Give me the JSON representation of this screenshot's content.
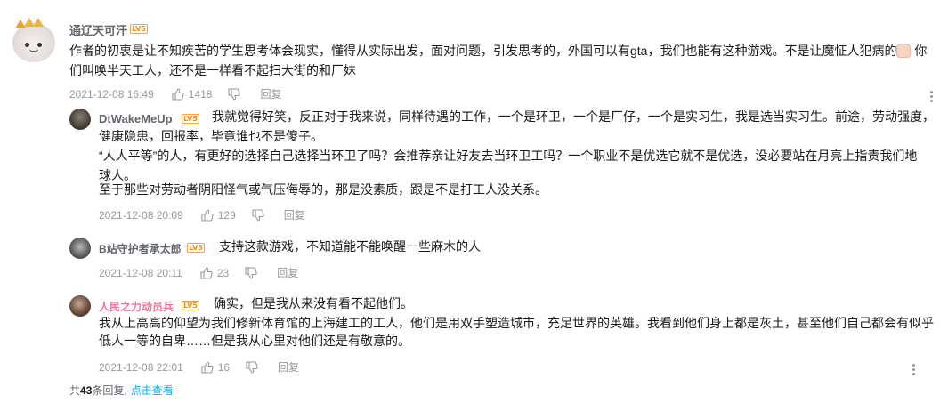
{
  "main_comment": {
    "username": "通辽天可汗",
    "level": "LV5",
    "text_line1_a": "作者的初衷是让不知疾苦的学生思考体会现实，懂得从实际出发，面对问题，引发思考的，外国可以有gta，我们也能有这种游戏。不是让魔怔人犯病的",
    "text_line1_b": "你",
    "text_line2": "们叫唤半天工人，还不是一样看不起扫大街的和厂妹",
    "time": "2021-12-08 16:49",
    "likes": "1418",
    "reply_label": "回复"
  },
  "replies": [
    {
      "username": "DtWakeMeUp",
      "level": "LV5",
      "lines": [
        "我就觉得好笑，反正对于我来说，同样待遇的工作，一个是环卫，一个是厂仔，一个是实习生，我是选当实习生。前途，劳动强度，",
        "健康隐患，回报率，毕竟谁也不是傻子。",
        "“人人平等”的人，有更好的选择自己选择当环卫了吗？会推荐亲让好友去当环卫工吗？一个职业不是优选它就不是优选，没必要站在月亮上指责我们地",
        "球人。",
        "至于那些对劳动者阴阳怪气或气压侮辱的，那是没素质，跟是不是打工人没关系。"
      ],
      "time": "2021-12-08 20:09",
      "likes": "129",
      "reply_label": "回复"
    },
    {
      "username": "B站守护者承太郎",
      "level": "LV5",
      "lines": [
        "支持这款游戏，不知道能不能唤醒一些麻木的人"
      ],
      "time": "2021-12-08 20:11",
      "likes": "23",
      "reply_label": "回复"
    },
    {
      "username": "人民之力动员兵",
      "level": "LV5",
      "lines": [
        "确实，但是我从来没有看不起他们。",
        "我从上高高的仰望为我们修新体育馆的上海建工的工人，他们是用双手塑造城市，充足世界的英雄。我看到他们身上都是灰土，甚至他们自己都会有似乎",
        "低人一等的自卑……但是我从心里对他们还是有敬意的。"
      ],
      "time": "2021-12-08 22:01",
      "likes": "16",
      "reply_label": "回复"
    }
  ],
  "footer": {
    "prefix": "共",
    "count": "43",
    "suffix": "条回复,",
    "link": "点击查看"
  },
  "colors": {
    "username": "#61666d",
    "vip_username": "#fb7299",
    "meta": "#9499a0",
    "link": "#00aeec",
    "level_badge": "#ff8a00"
  },
  "icons": [
    "like-icon",
    "dislike-icon",
    "more-icon"
  ]
}
